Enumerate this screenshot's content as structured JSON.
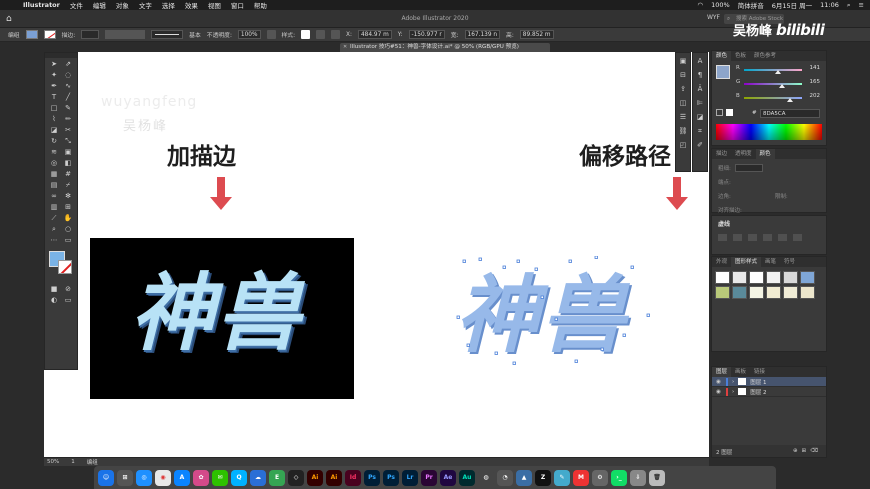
{
  "menubar": {
    "app": "Illustrator",
    "items": [
      "文件",
      "编辑",
      "对象",
      "文字",
      "选择",
      "效果",
      "视图",
      "窗口",
      "帮助"
    ],
    "right": [
      "100%",
      "简体拼音",
      "6月15日 周一",
      "11:06"
    ]
  },
  "appbar": {
    "title": "Adobe Illustrator 2020",
    "workspace": "WYF",
    "search_placeholder": "搜索 Adobe Stock"
  },
  "control": {
    "group_label": "编组",
    "stroke_label": "描边:",
    "line_style": "基本",
    "opacity_label": "不透明度:",
    "opacity_value": "100%",
    "style_label": "样式:",
    "x_value": "484.97 m",
    "y_value": "-150.977 r",
    "w_label": "宽:",
    "w_value": "167.139 n",
    "h_label": "高:",
    "h_value": "89.852 m"
  },
  "document_tab": "Illustrator 技巧#51：神兽-字体设计.ai* @ 50% (RGB/GPU 预览)",
  "canvas": {
    "watermark_en": "wuyangfeng",
    "watermark_cn": "吴杨峰",
    "left_heading": "加描边",
    "right_heading": "偏移路径",
    "left_text": "神兽",
    "right_text": "神兽"
  },
  "color_panel": {
    "tabs": [
      "颜色",
      "色板",
      "颜色参考"
    ],
    "r_label": "R",
    "r_value": "141",
    "g_label": "G",
    "g_value": "165",
    "b_label": "B",
    "b_value": "202",
    "hex_label": "#",
    "hex_value": "8DA5CA",
    "current_color": "#8DA5CA"
  },
  "stroke_panel": {
    "tabs": [
      "描边",
      "透明度",
      "颜色"
    ],
    "weight_label": "粗细:",
    "weight_value": "",
    "cap_label": "端点:",
    "corner_label": "边角:",
    "limit_label": "限制:",
    "align_label": "对齐描边:"
  },
  "appearance_panel": {
    "title": "虚线"
  },
  "styles_panel": {
    "tabs": [
      "外观",
      "图形样式",
      "画笔",
      "符号"
    ]
  },
  "layers_panel": {
    "tabs": [
      "图层",
      "画板",
      "链接"
    ],
    "layers": [
      {
        "name": "图层 1",
        "color": "#4a7fd9"
      },
      {
        "name": "图层 2",
        "color": "#e04040"
      }
    ],
    "footer": "2 图层"
  },
  "status": {
    "zoom": "50%",
    "artboard": "1",
    "mode": "编组"
  },
  "dock": {
    "apps": [
      "Ai",
      "Ai",
      "Id",
      "Ps",
      "Ps",
      "Lr",
      "Pr",
      "Ae",
      "Au"
    ]
  },
  "logo": {
    "name": "吴杨峰",
    "brand": "bilibili"
  }
}
